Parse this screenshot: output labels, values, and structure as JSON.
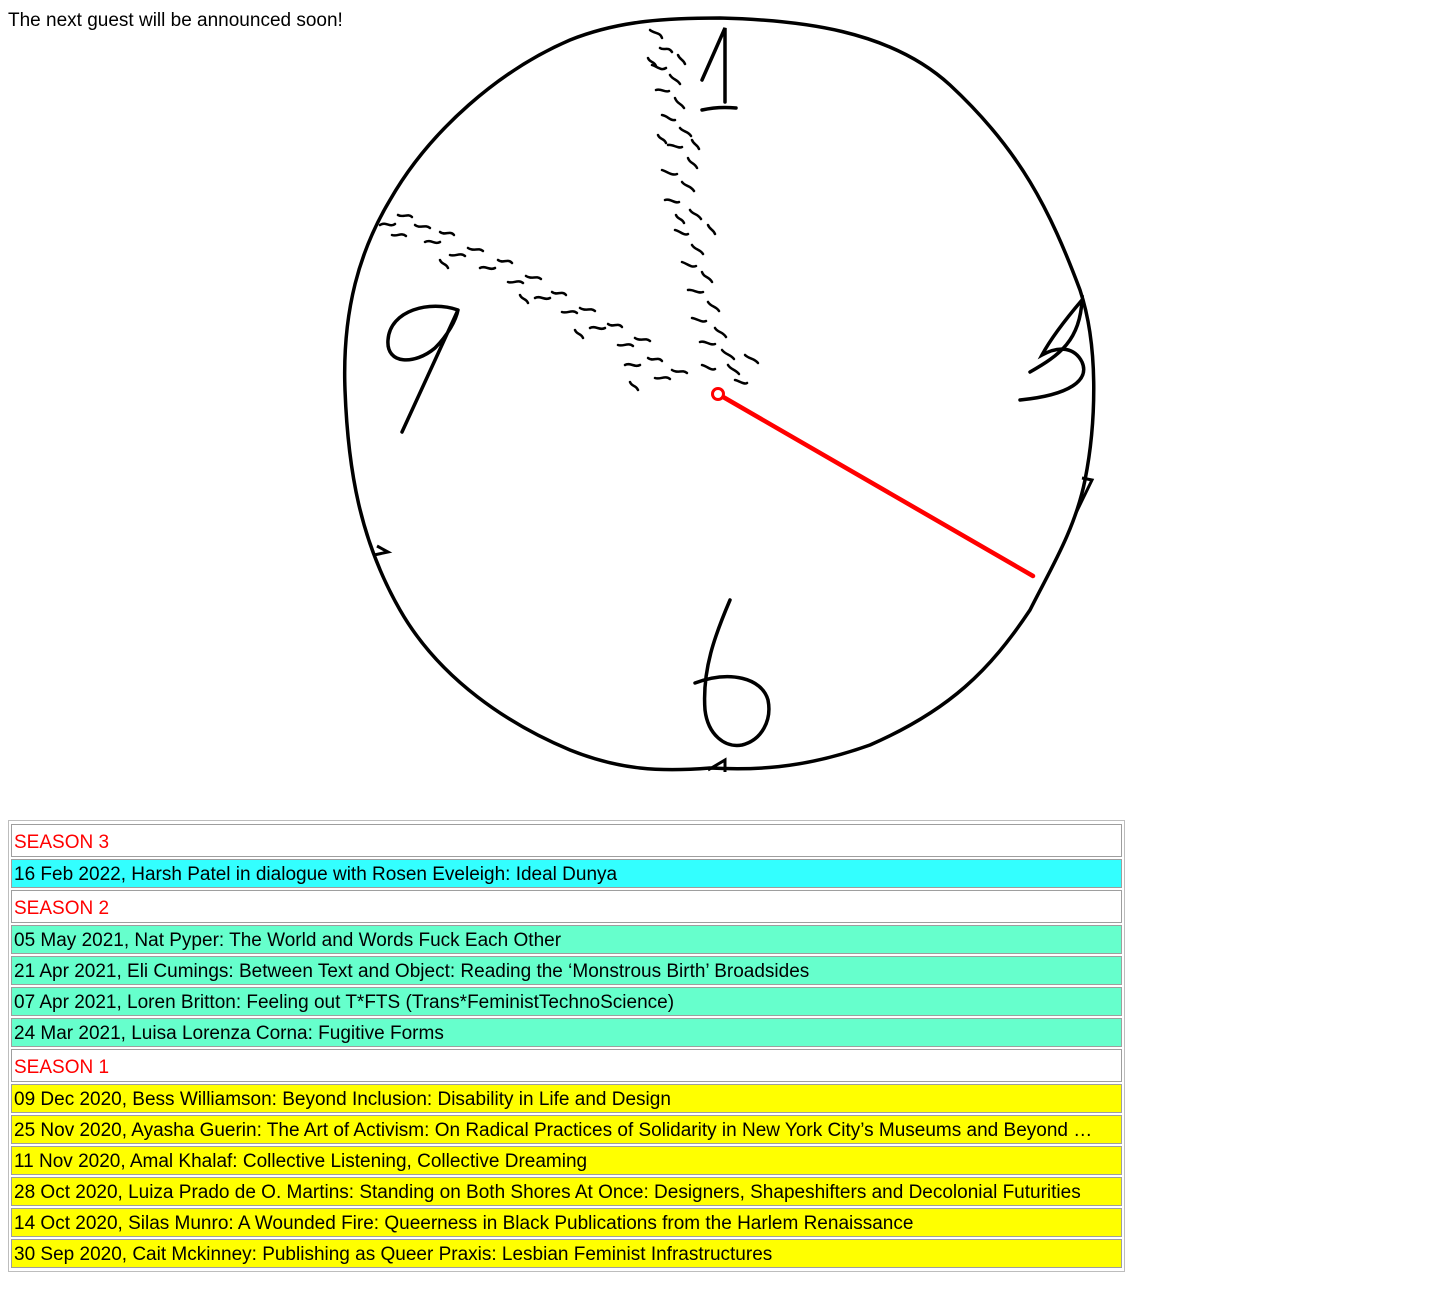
{
  "announcement": "The next guest will be announced soon!",
  "clock": {
    "numerals": [
      "1",
      "3",
      "6",
      "9"
    ],
    "second_hand_color": "#ff0000"
  },
  "colors": {
    "season_label": "#ff0000",
    "season3": "#33ffff",
    "season2": "#66ffcc",
    "season1": "#ffff00"
  },
  "seasons": [
    {
      "label": "SEASON 3",
      "color": "#33ffff",
      "episodes": [
        "16 Feb 2022, Harsh Patel in dialogue with Rosen Eveleigh: Ideal Dunya"
      ]
    },
    {
      "label": "SEASON 2",
      "color": "#66ffcc",
      "episodes": [
        "05 May 2021, Nat Pyper: The World and Words Fuck Each Other",
        "21 Apr 2021, Eli Cumings: Between Text and Object: Reading the ‘Monstrous Birth’ Broadsides",
        "07 Apr 2021, Loren Britton: Feeling out T*FTS (Trans*FeministTechnoScience)",
        "24 Mar 2021, Luisa Lorenza Corna: Fugitive Forms"
      ]
    },
    {
      "label": "SEASON 1",
      "color": "#ffff00",
      "episodes": [
        "09 Dec 2020, Bess Williamson: Beyond Inclusion: Disability in Life and Design",
        "25 Nov 2020, Ayasha Guerin: The Art of Activism: On Radical Practices of Solidarity in New York City’s Museums and Beyond …",
        "11 Nov 2020, Amal Khalaf: Collective Listening, Collective Dreaming",
        "28 Oct 2020, Luiza Prado de O. Martins: Standing on Both Shores At Once: Designers, Shapeshifters and Decolonial Futurities",
        "14 Oct 2020, Silas Munro: A Wounded Fire: Queerness in Black Publications from the Harlem Renaissance",
        "30 Sep 2020, Cait Mckinney: Publishing as Queer Praxis: Lesbian Feminist Infrastructures"
      ]
    }
  ]
}
